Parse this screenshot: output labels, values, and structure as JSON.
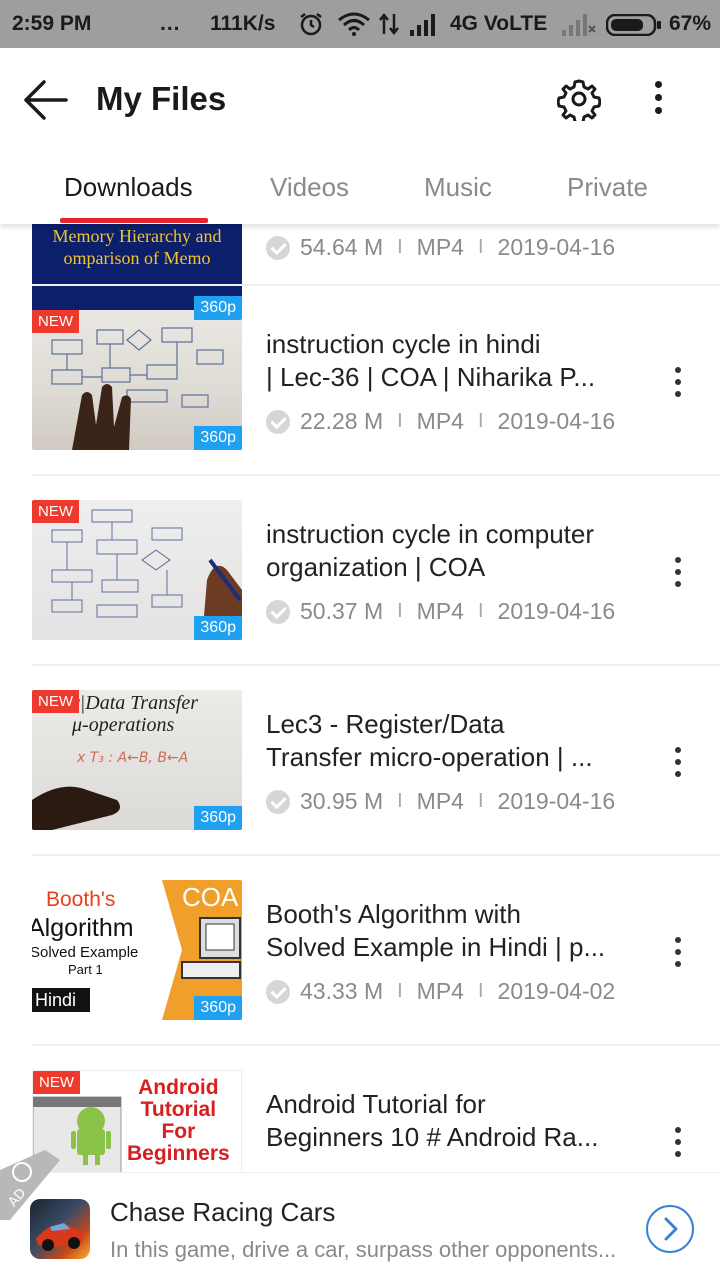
{
  "status_bar": {
    "time": "2:59 PM",
    "dots": "...",
    "speed": "111K/s",
    "network": "4G VoLTE",
    "battery_percent": "67%"
  },
  "app_bar": {
    "title": "My Files",
    "back_icon": "arrow-left-icon",
    "settings_icon": "gear-icon",
    "more_icon": "more-vert-icon"
  },
  "tabs": [
    {
      "label": "Downloads",
      "active": true
    },
    {
      "label": "Videos",
      "active": false
    },
    {
      "label": "Music",
      "active": false
    },
    {
      "label": "Private",
      "active": false
    }
  ],
  "files": [
    {
      "title": "",
      "size": "54.64 M",
      "format": "MP4",
      "date": "2019-04-16",
      "resolution": "360p",
      "is_new": false,
      "thumb_text": "Memory Hierarchy and\nomparison of Memo"
    },
    {
      "title": "instruction cycle in hindi\n| Lec-36 | COA | Niharika P...",
      "size": "22.28 M",
      "format": "MP4",
      "date": "2019-04-16",
      "resolution": "360p",
      "is_new": true
    },
    {
      "title": "instruction cycle in computer\norganization | COA",
      "size": "50.37 M",
      "format": "MP4",
      "date": "2019-04-16",
      "resolution": "360p",
      "is_new": true
    },
    {
      "title": "Lec3 - Register/Data\nTransfer micro-operation | ...",
      "size": "30.95 M",
      "format": "MP4",
      "date": "2019-04-16",
      "resolution": "360p",
      "is_new": true,
      "thumb_text": "r|Data Transfer\nμ-operations"
    },
    {
      "title": "Booth's Algorithm with\nSolved Example in Hindi | p...",
      "size": "43.33 M",
      "format": "MP4",
      "date": "2019-04-02",
      "resolution": "360p",
      "is_new": false,
      "thumb_text": "Booth's\nAlgorithm\nSolved Example\nPart 1\nHindi\nCOA"
    },
    {
      "title": "Android Tutorial for\nBeginners 10 # Android Ra...",
      "size": "",
      "format": "",
      "date": "",
      "resolution": "",
      "is_new": true,
      "thumb_text": "Android\nTutorial\nFor\nBeginners"
    }
  ],
  "labels": {
    "new_badge": "NEW"
  },
  "ad": {
    "title": "Chase Racing Cars",
    "description": "In this game, drive a car, surpass other opponents...",
    "corner_label": "AD",
    "go_icon": "chevron-right-circle-icon"
  },
  "colors": {
    "accent_red": "#e5252b",
    "new_badge": "#ee3a2c",
    "res_badge": "#1fa0f0",
    "ad_button": "#3a82d8"
  }
}
